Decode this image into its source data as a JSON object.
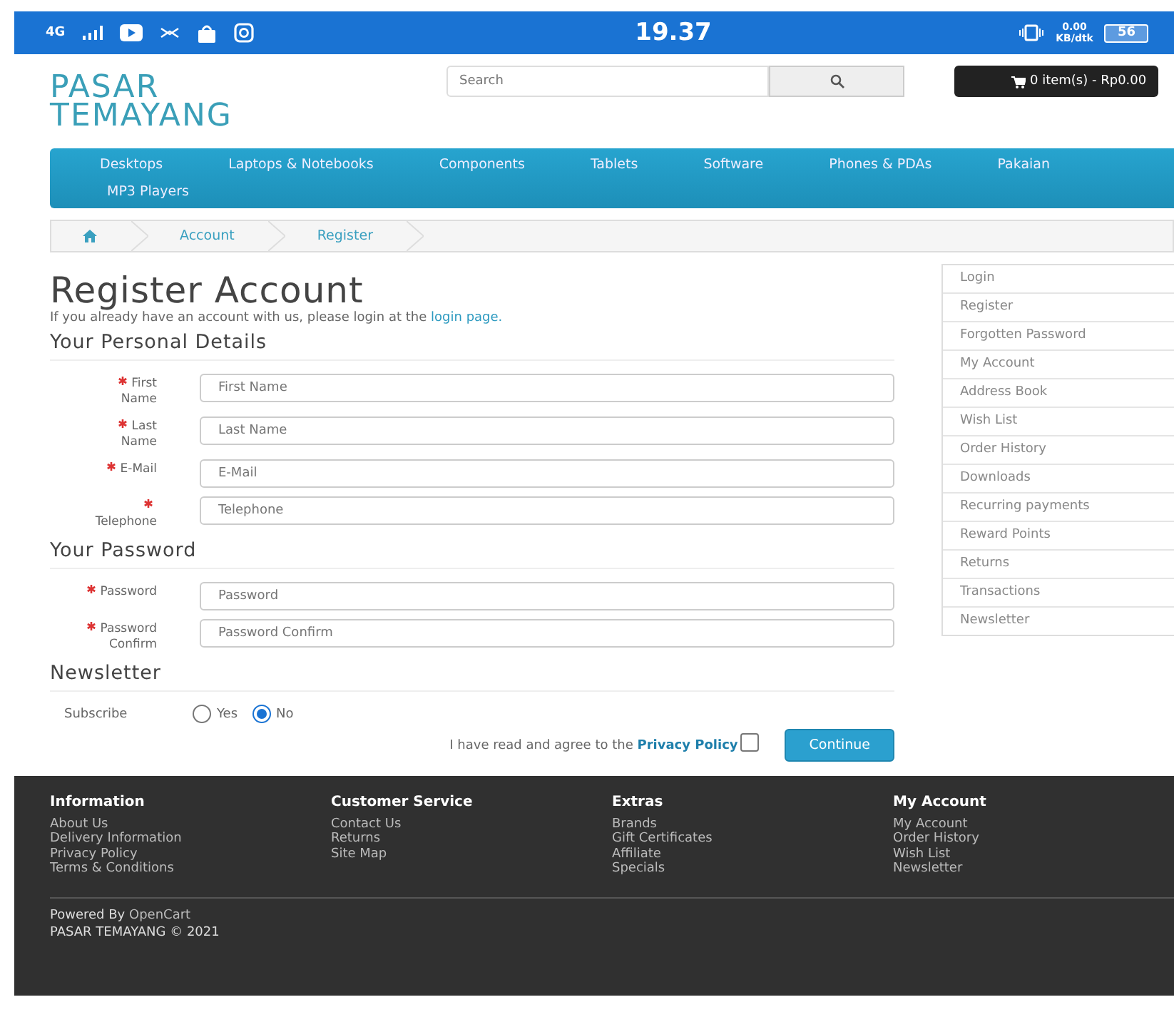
{
  "status_bar": {
    "network": "4G",
    "time": "19.37",
    "speed": "0.00",
    "speed_unit": "KB/dtk",
    "battery": "56"
  },
  "header": {
    "logo": [
      "PASAR",
      "TEMAYANG"
    ],
    "search": {
      "placeholder": "Search"
    },
    "cart": "0 item(s) - Rp0.00"
  },
  "menu": [
    "Desktops",
    "Laptops & Notebooks",
    "Components",
    "Tablets",
    "Software",
    "Phones & PDAs",
    "Pakaian",
    "MP3 Players"
  ],
  "breadcrumb": [
    "Account",
    "Register"
  ],
  "title": "Register Account",
  "intro": {
    "text": "If you already have an account with us, please login at the ",
    "link": "login page."
  },
  "sections": [
    {
      "title": "Your Personal Details",
      "fields": [
        {
          "label": "First Name",
          "placeholder": "First Name",
          "required": true
        },
        {
          "label": "Last Name",
          "placeholder": "Last Name",
          "required": true
        },
        {
          "label": "E-Mail",
          "placeholder": "E-Mail",
          "required": true
        },
        {
          "label": "Telephone",
          "placeholder": "Telephone",
          "required": true
        }
      ]
    },
    {
      "title": "Your Password",
      "fields": [
        {
          "label": "Password",
          "placeholder": "Password",
          "required": true
        },
        {
          "label": "Password Confirm",
          "placeholder": "Password Confirm",
          "required": true
        }
      ]
    }
  ],
  "newsletter": {
    "title": "Newsletter",
    "label": "Subscribe",
    "options": [
      {
        "label": "Yes",
        "selected": false
      },
      {
        "label": "No",
        "selected": true
      }
    ]
  },
  "agree": {
    "text": "I have read and agree to the ",
    "link": "Privacy Policy",
    "checked": false
  },
  "continue": "Continue",
  "sidebar": [
    "Login",
    "Register",
    "Forgotten Password",
    "My Account",
    "Address Book",
    "Wish List",
    "Order History",
    "Downloads",
    "Recurring payments",
    "Reward Points",
    "Returns",
    "Transactions",
    "Newsletter"
  ],
  "footer": {
    "columns": [
      {
        "title": "Information",
        "links": [
          "About Us",
          "Delivery Information",
          "Privacy Policy",
          "Terms & Conditions"
        ]
      },
      {
        "title": "Customer Service",
        "links": [
          "Contact Us",
          "Returns",
          "Site Map"
        ]
      },
      {
        "title": "Extras",
        "links": [
          "Brands",
          "Gift Certificates",
          "Affiliate",
          "Specials"
        ]
      },
      {
        "title": "My Account",
        "links": [
          "My Account",
          "Order History",
          "Wish List",
          "Newsletter"
        ]
      }
    ],
    "powered": "Powered By ",
    "powered_link": "OpenCart",
    "copyright": "PASAR TEMAYANG © 2021"
  }
}
